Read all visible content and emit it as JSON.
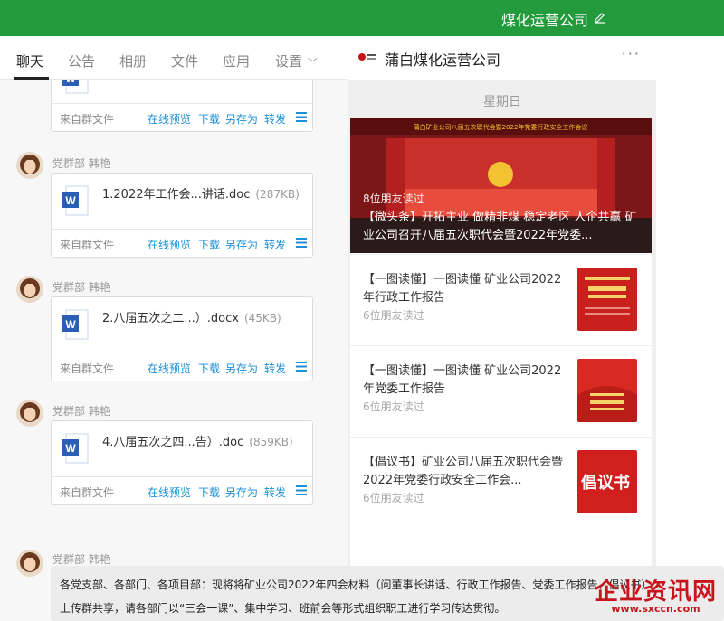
{
  "header": {
    "group_title": "煤化运营公司",
    "color": "#239b3c"
  },
  "tabs": [
    {
      "label": "聊天",
      "active": true
    },
    {
      "label": "公告"
    },
    {
      "label": "相册"
    },
    {
      "label": "文件"
    },
    {
      "label": "应用"
    },
    {
      "label": "设置"
    }
  ],
  "chat": {
    "file_actions": {
      "preview": "在线预览",
      "download": "下载",
      "save_as": "另存为",
      "forward": "转发",
      "source": "来自群文件"
    },
    "messages": [
      {
        "sender": "党群部 韩艳",
        "file_name": "1.2022年工作会...讲话.doc",
        "file_size": "(287KB)"
      },
      {
        "sender": "党群部 韩艳",
        "file_name": "2.八届五次之二...）.docx",
        "file_size": "(45KB)"
      },
      {
        "sender": "党群部 韩艳",
        "file_name": "4.八届五次之四...告）.doc",
        "file_size": "(859KB)"
      },
      {
        "sender": "党群部 韩艳"
      }
    ],
    "notice_lines": [
      "各党支部、各部门、各项目部：现将将矿业公司2022年四会材料（问董事长讲话、行政工作报告、党委工作报告、倡议书）",
      "上传群共享，请各部门以“三会一课”、集中学习、班前会等形式组织职工进行学习传达贯彻。"
    ]
  },
  "official_account": {
    "name": "蒲白煤化运营公司",
    "more": "···",
    "weekday": "星期日",
    "hero": {
      "readers": "8位朋友读过",
      "title": "【微头条】开拓主业 做精非煤 稳定老区 人企共赢 矿业公司召开八届五次职代会暨2022年党委..."
    },
    "articles": [
      {
        "title": "【一图读懂】一图读懂 矿业公司2022年行政工作报告",
        "readers": "6位朋友读过"
      },
      {
        "title": "【一图读懂】一图读懂 矿业公司2022年党委工作报告",
        "readers": "6位朋友读过"
      },
      {
        "title": "【倡议书】矿业公司八届五次职代会暨2022年党委行政安全工作会...",
        "readers": "6位朋友读过",
        "thumb_text": "倡议书"
      }
    ]
  },
  "watermark": {
    "main": "企业资讯网",
    "url": "www.sxccn.com"
  }
}
